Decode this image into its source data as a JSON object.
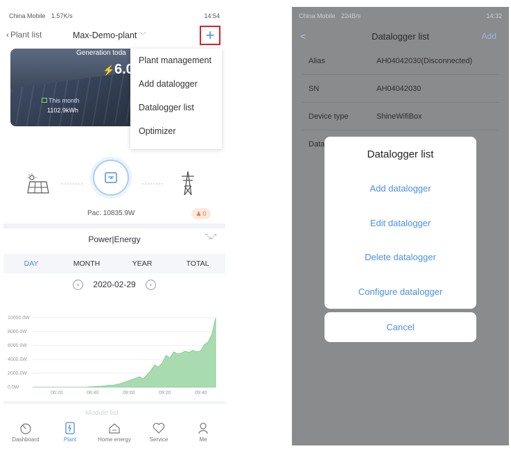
{
  "left": {
    "status": {
      "carrier": "China Mobile",
      "speed": "1.57K/s",
      "time": "14:54"
    },
    "topbar": {
      "back_label": "Plant list",
      "plant_name": "Max-Demo-plant",
      "plus_icon": "plus-icon"
    },
    "banner": {
      "generation_title": "Generation toda",
      "generation_value": "6.0",
      "month_label": "This month",
      "month_value": "1102.9kWh"
    },
    "dropdown": [
      "Plant management",
      "Add datalogger",
      "Datalogger list",
      "Optimizer"
    ],
    "flow": {
      "pac_label": "Pac: 10835.9W",
      "alarm_count": "0"
    },
    "power_energy": {
      "title": "Power|Energy",
      "tabs": [
        "DAY",
        "MONTH",
        "YEAR",
        "TOTAL"
      ],
      "active_tab": "DAY",
      "date": "2020-02-29"
    },
    "chart_data": {
      "type": "area",
      "y_ticks": [
        "10000.0W",
        "8000.0W",
        "6000.0W",
        "4000.0W",
        "2000.0W",
        "0.0W"
      ],
      "x_ticks": [
        "06:20",
        "08:40",
        "09:00",
        "09:20",
        "09:40"
      ],
      "ylim": [
        0,
        10000
      ],
      "series": [
        {
          "color": "#a8dcb0",
          "values": [
            0,
            0,
            0,
            0,
            0,
            0,
            0,
            0,
            0,
            0,
            0,
            0,
            0,
            0,
            0,
            50,
            80,
            120,
            150,
            200,
            300,
            260,
            400,
            500,
            700,
            900,
            1100,
            1300,
            1500,
            1200,
            1800,
            2400,
            3200,
            2900,
            3500,
            4600,
            4200,
            5100,
            4800,
            4900,
            5200,
            5000,
            5300,
            5100,
            5200,
            6100,
            6500,
            7600,
            10200
          ]
        }
      ]
    },
    "faded_text": "Module list",
    "nav": [
      {
        "label": "Dashboard",
        "icon": "dashboard-icon"
      },
      {
        "label": "Plant",
        "icon": "plant-icon"
      },
      {
        "label": "Home energy",
        "icon": "home-energy-icon"
      },
      {
        "label": "Service",
        "icon": "service-icon"
      },
      {
        "label": "Me",
        "icon": "me-icon"
      }
    ]
  },
  "right": {
    "status": {
      "carrier": "China Mobile",
      "speed": "224B/s",
      "time": "14:32"
    },
    "topbar": {
      "back": "<",
      "title": "Datalogger list",
      "add": "Add"
    },
    "rows": [
      {
        "key": "Alias",
        "value": "AH04042030(Disconnected)"
      },
      {
        "key": "SN",
        "value": "AH04042030"
      },
      {
        "key": "Device type",
        "value": "ShineWifiBox"
      },
      {
        "key": "Data",
        "value": ""
      }
    ],
    "sheet": {
      "title": "Datalogger list",
      "items": [
        "Add datalogger",
        "Edit datalogger",
        "Delete datalogger",
        "Configure datalogger"
      ],
      "cancel": "Cancel"
    }
  }
}
